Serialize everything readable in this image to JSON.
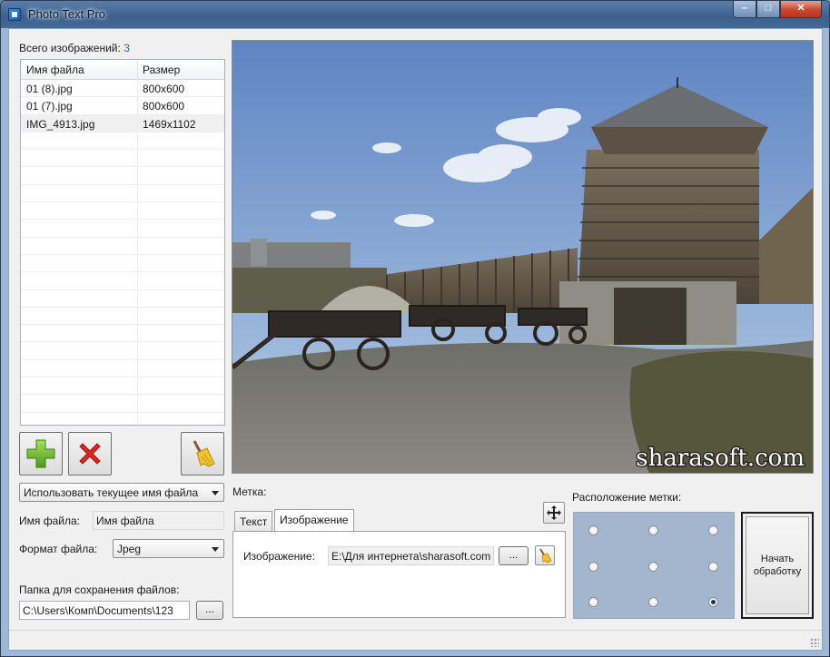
{
  "window": {
    "title": "Photo Text Pro",
    "min_label": "–",
    "max_label": "□",
    "close_label": "✕"
  },
  "files": {
    "count_label": "Всего изображений:",
    "count_value": "3",
    "columns": [
      "Имя файла",
      "Размер"
    ],
    "rows": [
      {
        "name": "01 (8).jpg",
        "size": "800x600"
      },
      {
        "name": "01 (7).jpg",
        "size": "800x600"
      },
      {
        "name": "IMG_4913.jpg",
        "size": "1469x1102"
      }
    ],
    "buttons": {
      "add_icon": "plus-icon",
      "remove_icon": "cross-icon",
      "clear_icon": "broom-icon"
    }
  },
  "options": {
    "naming_mode": "Использовать текущее имя файла",
    "filename_label": "Имя файла:",
    "filename_value": "Имя файла",
    "format_label": "Формат файла:",
    "format_value": "Jpeg",
    "save_folder_label": "Папка для сохранения файлов:",
    "save_folder_value": "C:\\Users\\Комп\\Documents\\123",
    "browse_label": "..."
  },
  "preview": {
    "watermark_text": "sharasoft.com"
  },
  "mark": {
    "label": "Метка:",
    "tabs": [
      "Текст",
      "Изображение"
    ],
    "active_tab": 1,
    "image_label": "Изображение:",
    "image_path": "E:\\Для интернета\\sharasoft.com",
    "browse_label": "..."
  },
  "position": {
    "label": "Расположение метки:",
    "selected": "bottom-right"
  },
  "start_button": "Начать обработку",
  "colors": {
    "accent": "#1f6fc5",
    "position_panel": "#a3b6cd"
  }
}
